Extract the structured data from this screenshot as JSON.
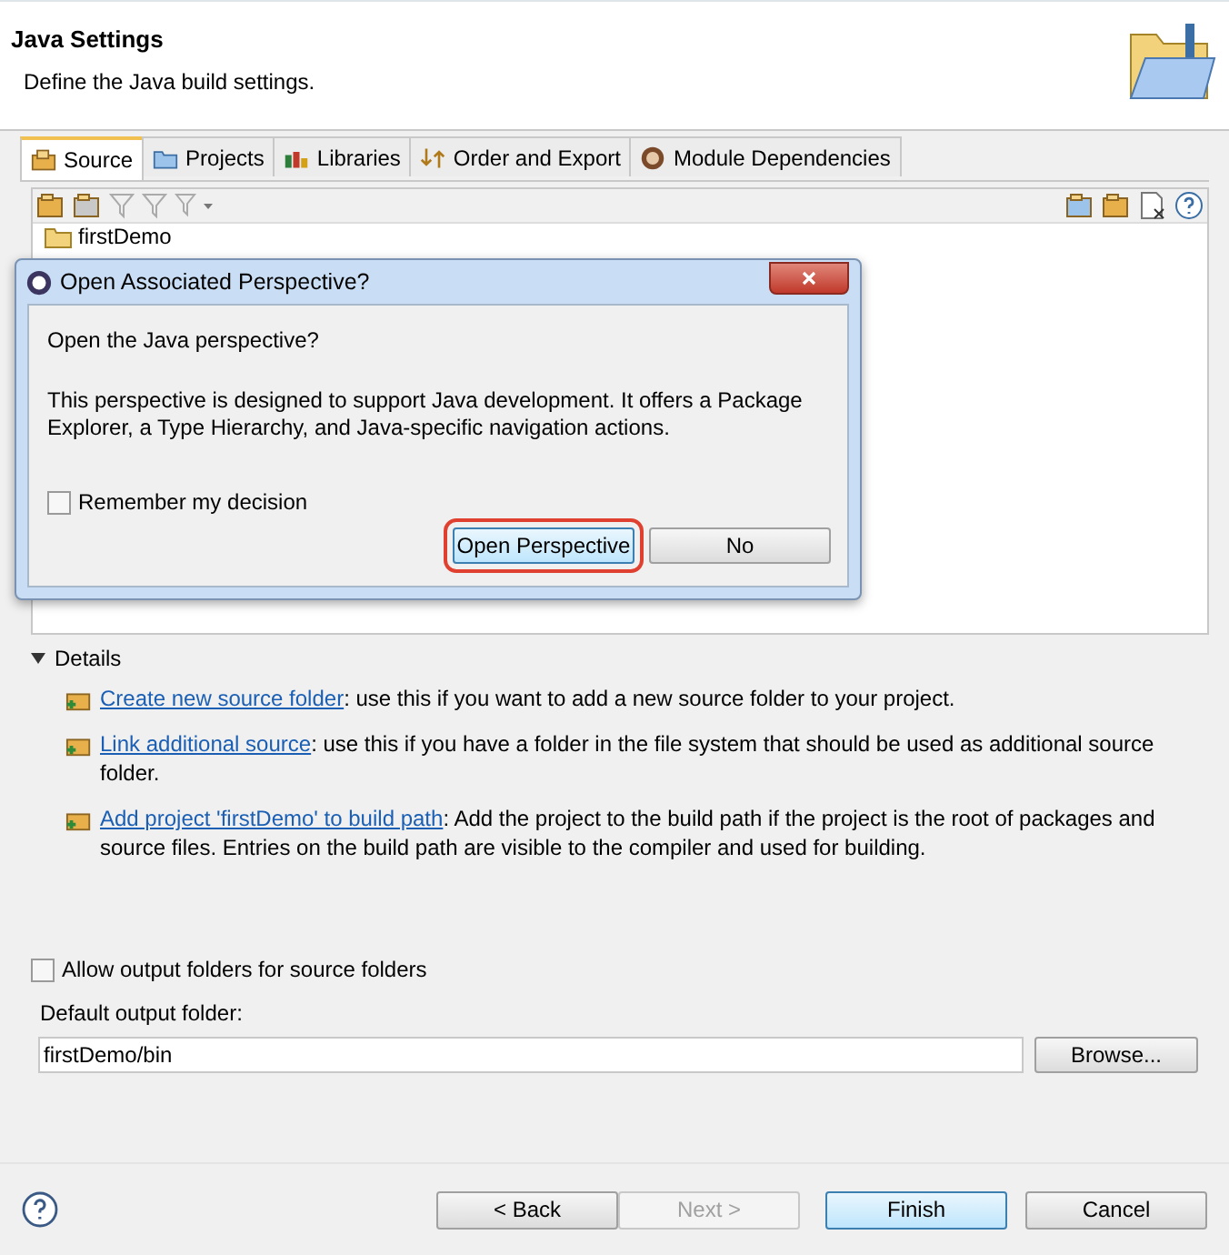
{
  "header": {
    "title": "Java Settings",
    "description": "Define the Java build settings."
  },
  "tabs": [
    {
      "label": "Source",
      "selected": true,
      "kind": "source"
    },
    {
      "label": "Projects",
      "selected": false,
      "kind": "projects"
    },
    {
      "label": "Libraries",
      "selected": false,
      "kind": "libraries"
    },
    {
      "label": "Order and Export",
      "selected": false,
      "kind": "order"
    },
    {
      "label": "Module Dependencies",
      "selected": false,
      "kind": "module"
    }
  ],
  "tree": {
    "items": [
      {
        "label": "firstDemo"
      }
    ]
  },
  "dialog": {
    "title": "Open Associated Perspective?",
    "question": "Open the Java perspective?",
    "message": "This perspective is designed to support Java development. It offers a Package Explorer, a Type Hierarchy, and Java-specific navigation actions.",
    "remember": {
      "label": "Remember my decision",
      "checked": false
    },
    "buttons": [
      {
        "label": "Open Perspective",
        "highlighted": true
      },
      {
        "label": "No",
        "highlighted": false
      }
    ]
  },
  "details": {
    "label": "Details",
    "expanded": true,
    "items": [
      {
        "link": "Create new source folder",
        "text": ": use this if you want to add a new source folder to your project."
      },
      {
        "link": "Link additional source",
        "text": ": use this if you have a folder in the file system that should be used as additional source folder."
      },
      {
        "link": "Add project 'firstDemo' to build path",
        "text": ": Add the project to the build path if the project is the root of packages and source files. Entries on the build path are visible to the compiler and used for building."
      }
    ]
  },
  "allow_output": {
    "label": "Allow output folders for source folders",
    "checked": false
  },
  "output_folder": {
    "label": "Default output folder:",
    "value": "firstDemo/bin",
    "browse": "Browse..."
  },
  "footer": {
    "buttons": [
      {
        "label": "< Back",
        "disabled": false,
        "default": false
      },
      {
        "label": "Next >",
        "disabled": true,
        "default": false
      },
      {
        "label": "Finish",
        "disabled": false,
        "default": true
      },
      {
        "label": "Cancel",
        "disabled": false,
        "default": false
      }
    ]
  }
}
